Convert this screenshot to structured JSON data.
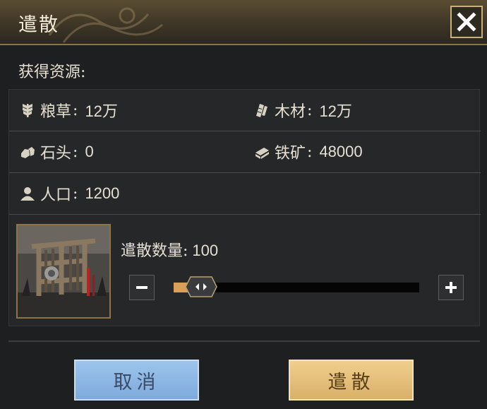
{
  "dialog": {
    "title": "遣散",
    "close_icon": "close-icon"
  },
  "resources": {
    "section_label": "获得资源:",
    "items": [
      {
        "icon": "grain-icon",
        "label": "粮草",
        "colon": ":",
        "value": "12万"
      },
      {
        "icon": "wood-icon",
        "label": "木材",
        "colon": ":",
        "value": "12万"
      },
      {
        "icon": "stone-icon",
        "label": "石头",
        "colon": ":",
        "value": "0"
      },
      {
        "icon": "iron-ore-icon",
        "label": "铁矿",
        "colon": ":",
        "value": "48000"
      },
      {
        "icon": "population-icon",
        "label": "人口",
        "colon": ":",
        "value": "1200"
      }
    ]
  },
  "dismiss": {
    "quantity_label": "遣散数量:",
    "quantity_value": "100",
    "slider_fraction": 0.1,
    "unit_image": "siege-engine-portrait"
  },
  "buttons": {
    "cancel_label": "取消",
    "confirm_label": "遣散"
  },
  "colors": {
    "accent_gold": "#c8b078",
    "slider_fill": "#d9a05a",
    "cancel_blue": "#8bb6e4",
    "confirm_gold": "#e4bf7a"
  }
}
